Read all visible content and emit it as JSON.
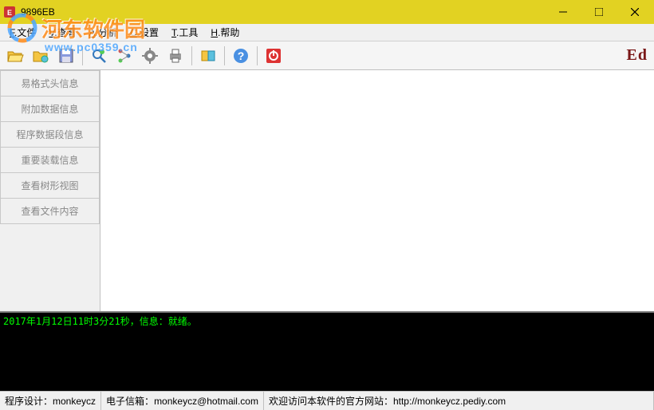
{
  "window": {
    "title": "9896EB"
  },
  "watermark": {
    "text": "河东软件园",
    "url": "www.pc0359.cn"
  },
  "menus": [
    {
      "key": "F",
      "label": "文件"
    },
    {
      "key": "V",
      "label": "查看"
    },
    {
      "key": "A",
      "label": "分析"
    },
    {
      "key": "C",
      "label": "设置"
    },
    {
      "key": "T",
      "label": "工具"
    },
    {
      "key": "H",
      "label": "帮助"
    }
  ],
  "sidebar": {
    "tabs": [
      "易格式头信息",
      "附加数据信息",
      "程序数据段信息",
      "重要装载信息",
      "查看树形视图",
      "查看文件内容"
    ]
  },
  "console": {
    "line1": "2017年1月12日11时3分21秒，信息：就绪。"
  },
  "status": {
    "author_label": "程序设计：",
    "author": "monkeycz",
    "email_label": "电子信箱：",
    "email": "monkeycz@hotmail.com",
    "site_label": "欢迎访问本软件的官方网站：",
    "site": "http://monkeycz.pediy.com"
  },
  "logo_right": "Ed"
}
